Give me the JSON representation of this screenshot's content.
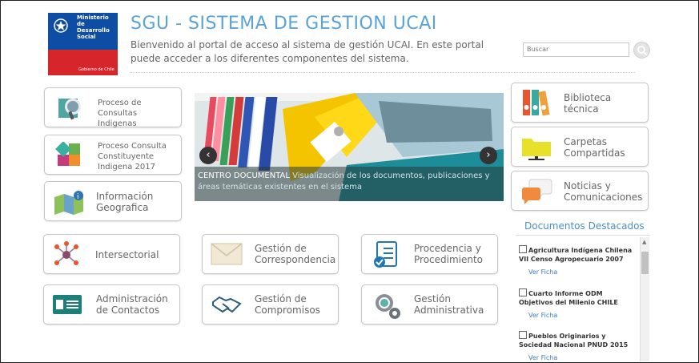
{
  "logo": {
    "ministry": "Ministerio de Desarrollo Social",
    "government": "Gobierno de Chile",
    "colors": {
      "blue": "#0d4da3",
      "red": "#d7262b"
    }
  },
  "header": {
    "title": "SGU - SISTEMA DE GESTION UCAI",
    "intro": "Bienvenido al portal de acceso al sistema de gestión UCAI. En este portal puede acceder a los diferentes componentes del sistema."
  },
  "search": {
    "placeholder": "Buscar",
    "icon": "search-icon"
  },
  "left_tiles": [
    {
      "label": "Proceso de Consultas Indigenas",
      "icon": "consulta-icon"
    },
    {
      "label": "Proceso Consulta Constituyente Indigena 2017",
      "icon": "constituyente-icon"
    },
    {
      "label": "Información Geografica",
      "icon": "map-icon"
    }
  ],
  "carousel": {
    "caption_lead": "CENTRO DOCUMENTAL",
    "caption_rest": " Visualización de los documentos, publicaciones y áreas temáticas existentes en el sistema",
    "prev": "‹",
    "next": "›"
  },
  "right_tiles": [
    {
      "label": "Biblioteca técnica",
      "icon": "binders-icon"
    },
    {
      "label": "Carpetas Compartidas",
      "icon": "shared-folder-icon"
    },
    {
      "label": "Noticias y Comunicaciones",
      "icon": "chat-bubbles-icon"
    }
  ],
  "bottom_tiles": [
    {
      "label": "Intersectorial",
      "icon": "network-icon"
    },
    {
      "label": "Gestión de Correspondencia",
      "icon": "envelope-icon"
    },
    {
      "label": "Procedencia y Procedimiento",
      "icon": "checklist-icon"
    },
    {
      "label": "Administración de Contactos",
      "icon": "contact-card-icon"
    },
    {
      "label": "Gestión de Compromisos",
      "icon": "handshake-icon"
    },
    {
      "label": "Gestión Administrativa",
      "icon": "gears-icon"
    }
  ],
  "documents": {
    "title": "Documentos Destacados",
    "items": [
      {
        "title": "Agricultura Indígena Chilena VII Censo Agropecuario 2007",
        "link": "Ver Ficha"
      },
      {
        "title": "Cuarto Informe ODM Objetivos del Milenio CHILE",
        "link": "Ver Ficha"
      },
      {
        "title": "Pueblos Originarios y Sociedad Nacional PNUD 2015",
        "link": "Ver Ficha"
      }
    ]
  },
  "colors": {
    "accent": "#5aa3d6",
    "link": "#3d7bbf"
  }
}
